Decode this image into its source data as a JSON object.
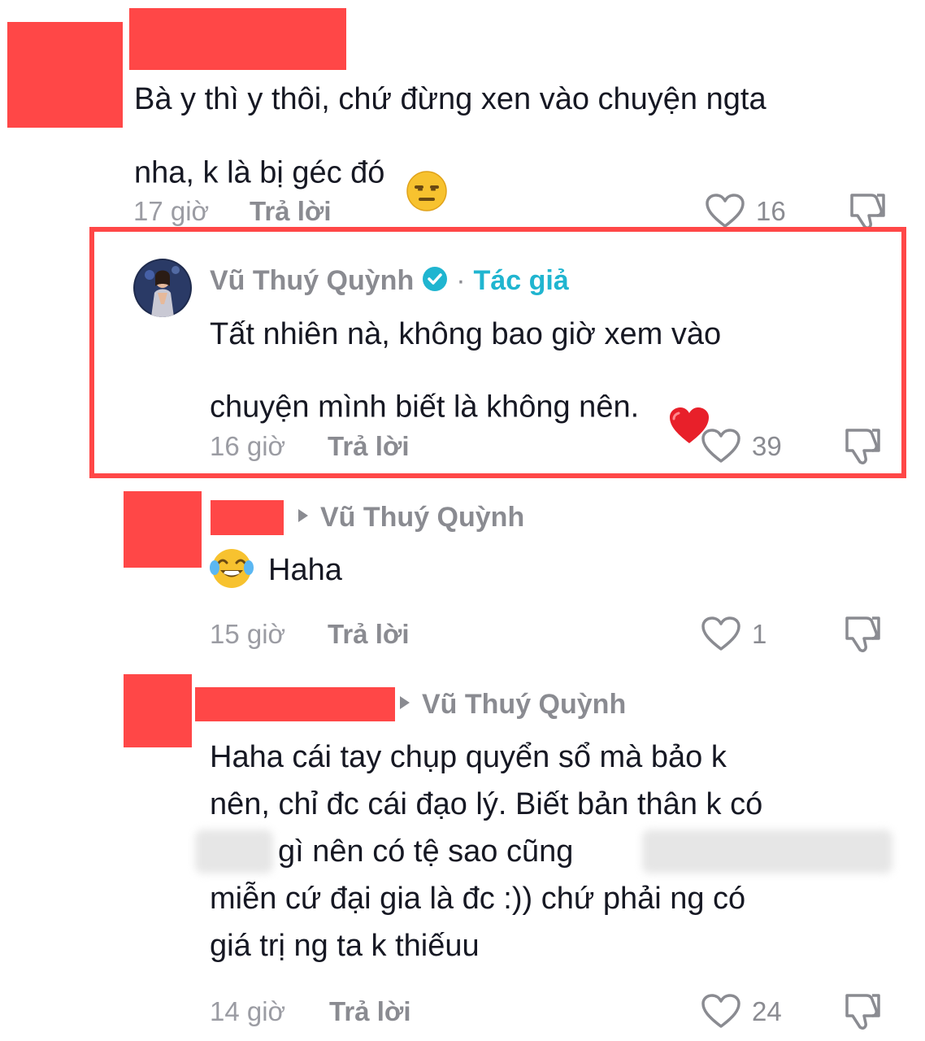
{
  "colors": {
    "redaction": "#ff4747",
    "text_primary": "#161823",
    "text_secondary": "#8a8b91",
    "author_accent": "#20b5d0",
    "heart_emoji": "#e8202a"
  },
  "comments": [
    {
      "text": "Bà y thì y thôi, chứ đừng xen vào chuyện ngta\nnha, k là bị géc đó",
      "emoji": "expressionless-face",
      "time": "17 giờ",
      "reply_label": "Trả lời",
      "likes": "16"
    },
    {
      "username": "Vũ Thuý Quỳnh",
      "separator": "·",
      "author_label": "Tác giả",
      "text": "Tất nhiên nà, không bao giờ xem vào\nchuyện mình biết là không nên.",
      "emoji": "red-heart",
      "time": "16 giờ",
      "reply_label": "Trả lời",
      "likes": "39"
    },
    {
      "reply_to": "Vũ Thuý Quỳnh",
      "text": "Haha",
      "emoji": "face-with-tears-of-joy",
      "time": "15 giờ",
      "reply_label": "Trả lời",
      "likes": "1"
    },
    {
      "reply_to": "Vũ Thuý Quỳnh",
      "line1": "Haha cái tay chụp quyển sổ mà bảo k",
      "line2": "nên, chỉ đc cái đạo lý. Biết bản thân k có",
      "line3": "gì nên có tệ sao cũng",
      "line4": "miễn cứ đại gia là đc :)) chứ phải ng có",
      "line5": "giá trị ng ta k thiếuu",
      "time": "14 giờ",
      "reply_label": "Trả lời",
      "likes": "24"
    }
  ]
}
